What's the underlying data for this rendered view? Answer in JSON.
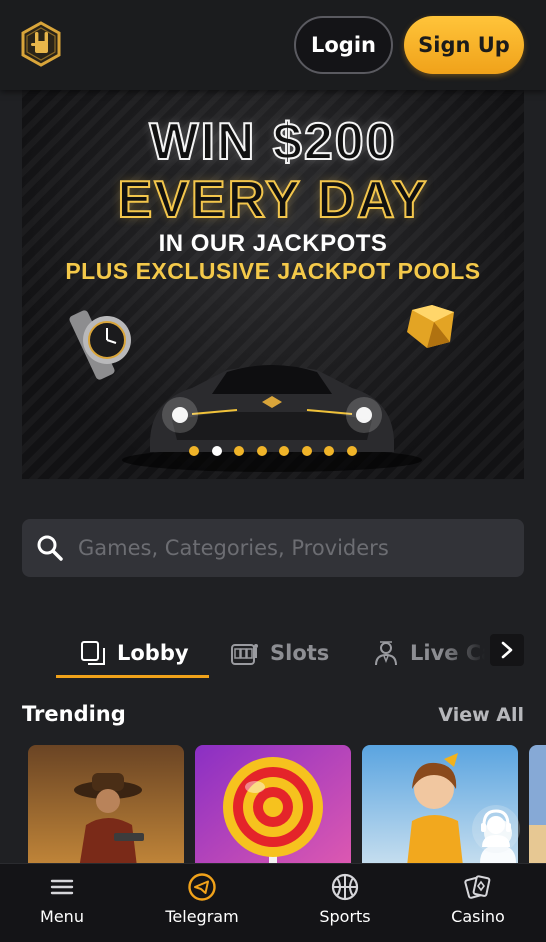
{
  "header": {
    "login_label": "Login",
    "signup_label": "Sign Up",
    "logo_icon": "rock-hand-hexagon-logo"
  },
  "banner": {
    "line1": "WIN $200",
    "line2": "EVERY DAY",
    "line3": "IN OUR JACKPOTS",
    "line4": "PLUS EXCLUSIVE JACKPOT POOLS",
    "slide_count": 8,
    "active_slide": 2,
    "colors": {
      "gold": "#f0b429",
      "dot_active": "#ffffff"
    }
  },
  "search": {
    "placeholder": "Games, Categories, Providers",
    "value": "",
    "icon": "search-icon"
  },
  "tabs": {
    "items": [
      {
        "label": "Lobby",
        "icon": "lobby-icon",
        "active": true
      },
      {
        "label": "Slots",
        "icon": "slot-machine-icon",
        "active": false
      },
      {
        "label": "Live Ca",
        "icon": "live-dealer-icon",
        "active": false
      }
    ],
    "scroll_icon": "chevron-right-icon"
  },
  "trending": {
    "title": "Trending",
    "view_all_label": "View All",
    "cards": [
      {
        "icon": "cowboy-game-thumbnail"
      },
      {
        "icon": "lollipop-game-thumbnail"
      },
      {
        "icon": "cartoon-girl-game-thumbnail"
      },
      {
        "icon": "partial-game-thumbnail"
      }
    ],
    "support_icon": "headset-support-icon"
  },
  "bottom_nav": {
    "items": [
      {
        "label": "Menu",
        "icon": "hamburger-menu-icon"
      },
      {
        "label": "Telegram",
        "icon": "telegram-icon"
      },
      {
        "label": "Sports",
        "icon": "basketball-icon"
      },
      {
        "label": "Casino",
        "icon": "casino-cards-icon"
      }
    ]
  },
  "colors": {
    "accent": "#f0a21a",
    "background": "#1f2023",
    "header": "#1b1c1e",
    "search_bg": "#323338"
  }
}
